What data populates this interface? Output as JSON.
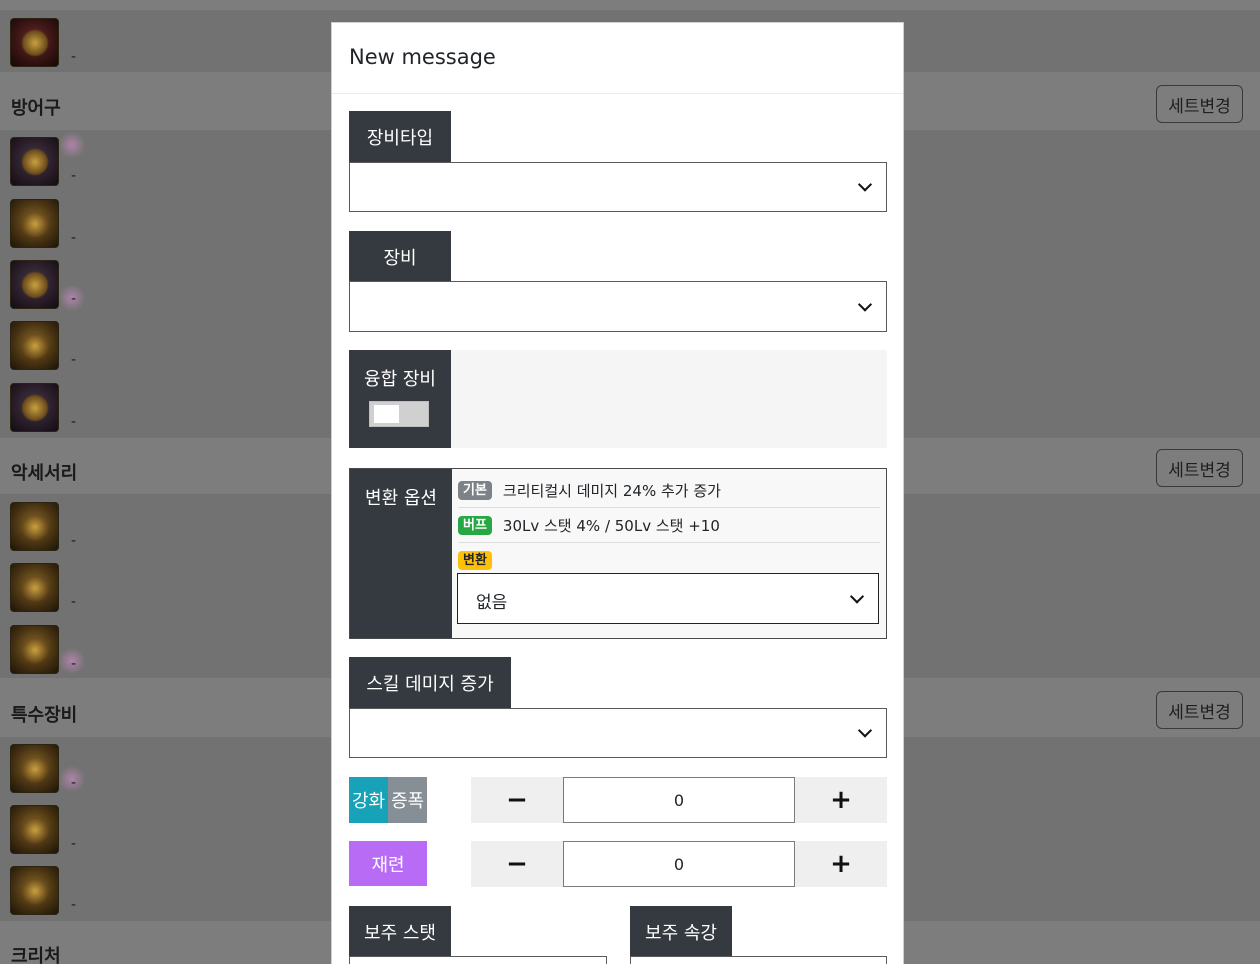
{
  "background": {
    "sections": [
      {
        "title": "방어구",
        "set_button": "세트변경"
      },
      {
        "title": "악세서리",
        "set_button": "세트변경"
      },
      {
        "title": "특수장비",
        "set_button": "세트변경"
      },
      {
        "title": "크리처"
      }
    ],
    "item_dash": "-"
  },
  "modal": {
    "title": "New message",
    "equip_type": {
      "label": "장비타입",
      "value": ""
    },
    "equip": {
      "label": "장비",
      "value": ""
    },
    "fusion": {
      "label": "융합 장비",
      "toggle_on": false
    },
    "conversion_options": {
      "label": "변환 옵션",
      "basic": {
        "badge": "기본",
        "text": "크리티컬시 데미지 24% 추가 증가"
      },
      "buff": {
        "badge": "버프",
        "text": "30Lv 스탯 4% / 50Lv 스탯 +10"
      },
      "convert": {
        "badge": "변환",
        "selected": "없음"
      }
    },
    "skill_damage": {
      "label": "스킬 데미지 증가",
      "value": ""
    },
    "reinforce": {
      "tag1": "강화",
      "tag2": "증폭",
      "minus": "−",
      "value": "0",
      "plus": "+"
    },
    "refine": {
      "tag": "재련",
      "minus": "−",
      "value": "0",
      "plus": "+"
    },
    "sub_stat": {
      "label": "보주 스탯"
    },
    "sub_element": {
      "label": "보주 속강"
    }
  },
  "colors": {
    "dark_label": "#343a40",
    "reinforce": "#17a2b8",
    "amplify": "#868e96",
    "refine": "#b86cf5",
    "badge_basic": "#7c8287",
    "badge_buff": "#28a745",
    "badge_convert": "#ffc107"
  }
}
